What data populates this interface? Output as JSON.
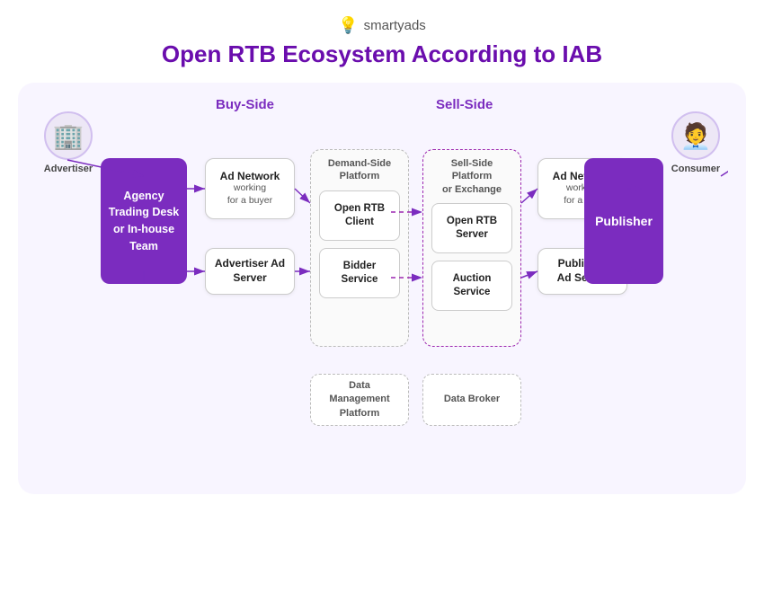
{
  "logo": {
    "text": "smartyads",
    "icon": "💡"
  },
  "title": "Open RTB Ecosystem According to IAB",
  "sections": {
    "buy_side": "Buy-Side",
    "sell_side": "Sell-Side"
  },
  "nodes": {
    "advertiser": "Advertiser",
    "consumer": "Consumer",
    "agency_trading_desk": "Agency\nTrading Desk\nor In-house\nTeam",
    "ad_network_buyer": {
      "title": "Ad Network",
      "sub": "working\nfor a buyer"
    },
    "advertiser_ad_server": {
      "title": "Advertiser\nAd Server",
      "sub": ""
    },
    "dsp": {
      "label": "Demand-Side\nPlatform",
      "inner": [
        {
          "title": "Open RTB\nClient",
          "sub": ""
        },
        {
          "title": "Bidder\nService",
          "sub": ""
        }
      ]
    },
    "ssp": {
      "label": "Sell-Side\nPlatform\nor Exchange",
      "inner": [
        {
          "title": "Open RTB\nServer",
          "sub": ""
        },
        {
          "title": "Auction\nService",
          "sub": ""
        }
      ]
    },
    "ad_network_pub": {
      "title": "Ad Network",
      "sub": "working\nfor a pub"
    },
    "publisher_ad_server": {
      "title": "Publisher\nAd Server",
      "sub": ""
    },
    "publisher": "Publisher",
    "dmp": {
      "title": "Data\nManagement\nPlatform",
      "sub": ""
    },
    "data_broker": {
      "title": "Data Broker",
      "sub": ""
    }
  },
  "colors": {
    "purple": "#7b2cbf",
    "light_purple": "#ede7f6",
    "bg": "#f8f5ff",
    "arrow": "#7b2cbf",
    "dashed": "#9c27b0"
  }
}
